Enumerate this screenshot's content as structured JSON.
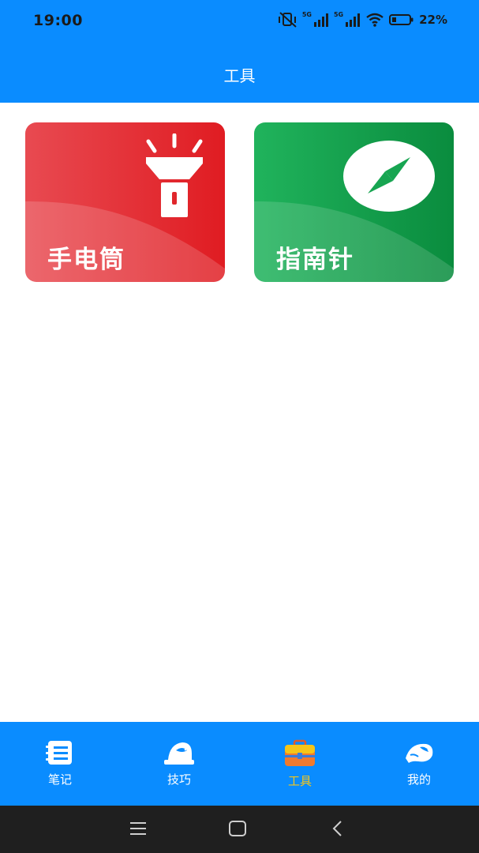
{
  "status_bar": {
    "time": "19:00",
    "network_1": "5G",
    "network_2": "5G",
    "battery": "22%",
    "icons": [
      "mute-vibrate-icon",
      "signal-icon",
      "signal-icon",
      "wifi-icon",
      "battery-icon"
    ]
  },
  "header": {
    "title": "工具"
  },
  "tools": [
    {
      "label": "手电筒",
      "icon": "flashlight-icon",
      "color": "#e8232c"
    },
    {
      "label": "指南针",
      "icon": "compass-icon",
      "color": "#17a551"
    }
  ],
  "bottom_nav": {
    "active_index": 2,
    "active_color": "#f5c518",
    "items": [
      {
        "label": "笔记",
        "icon": "notebook-icon"
      },
      {
        "label": "技巧",
        "icon": "fishing-hat-icon"
      },
      {
        "label": "工具",
        "icon": "toolbox-icon"
      },
      {
        "label": "我的",
        "icon": "fish-icon"
      }
    ]
  },
  "system_nav": {
    "icons": [
      "menu-icon",
      "home-icon",
      "back-icon"
    ]
  },
  "colors": {
    "primary": "#0a8cff",
    "system_bar": "#1f1f1f"
  }
}
